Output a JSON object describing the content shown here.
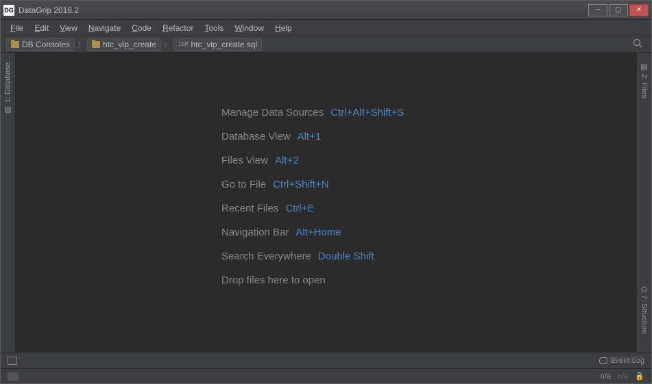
{
  "window": {
    "title": "DataGrip 2016.2",
    "icon_text": "DG"
  },
  "menu": [
    "File",
    "Edit",
    "View",
    "Navigate",
    "Code",
    "Refactor",
    "Tools",
    "Window",
    "Help"
  ],
  "breadcrumbs": [
    {
      "label": "DB Consoles",
      "type": "folder"
    },
    {
      "label": "htc_vip_create",
      "type": "folder"
    },
    {
      "label": "htc_vip_create.sql",
      "type": "sql"
    }
  ],
  "hints": [
    {
      "label": "Manage Data Sources",
      "key": "Ctrl+Alt+Shift+S"
    },
    {
      "label": "Database View",
      "key": "Alt+1"
    },
    {
      "label": "Files View",
      "key": "Alt+2"
    },
    {
      "label": "Go to File",
      "key": "Ctrl+Shift+N"
    },
    {
      "label": "Recent Files",
      "key": "Ctrl+E"
    },
    {
      "label": "Navigation Bar",
      "key": "Alt+Home"
    },
    {
      "label": "Search Everywhere",
      "key": "Double Shift"
    },
    {
      "label": "Drop files here to open",
      "key": ""
    }
  ],
  "left_tabs": {
    "database": "1: Database"
  },
  "right_tabs": {
    "files": "2: Files",
    "structure": "7: Structure"
  },
  "status": {
    "event_log": "Event Log",
    "info": "n/a",
    "extra": "n/a"
  },
  "watermark": "51CTO博客"
}
